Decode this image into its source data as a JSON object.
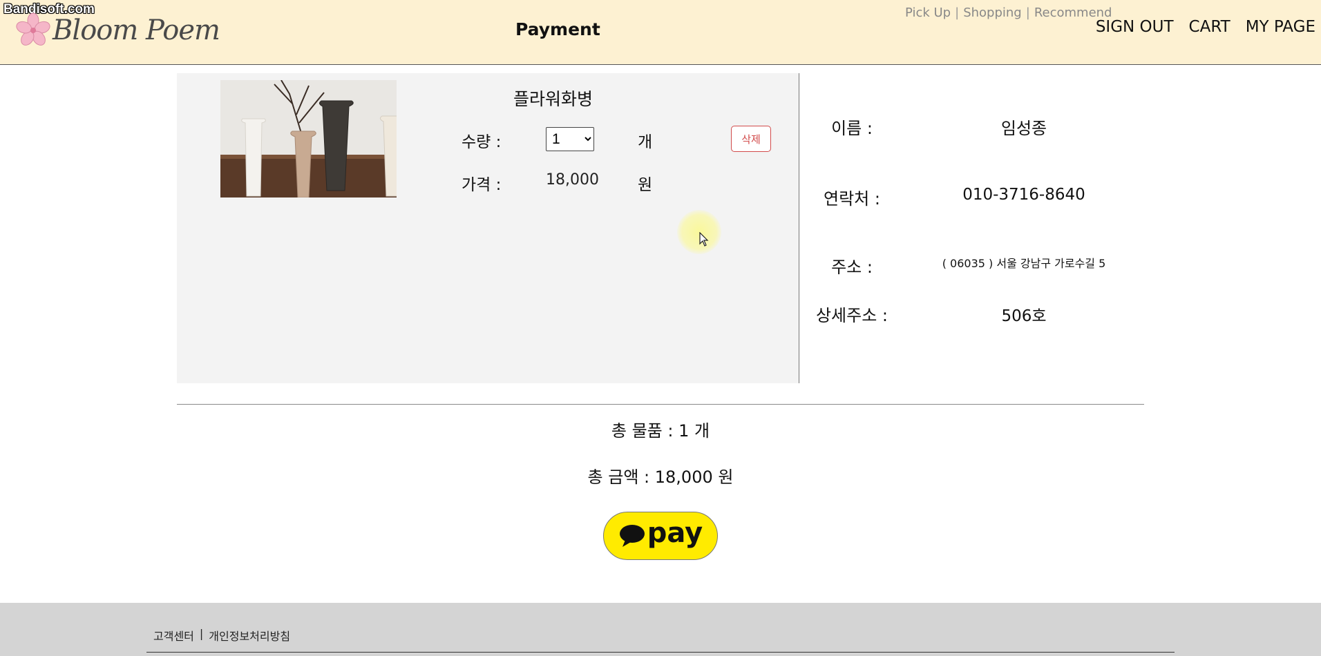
{
  "watermark": "Bandisoft.com",
  "header": {
    "logo_text": "Bloom Poem",
    "page_title": "Payment",
    "subnav": [
      "Pick Up",
      "Shopping",
      "Recommend"
    ],
    "mainnav": [
      "SIGN OUT",
      "CART",
      "MY PAGE"
    ]
  },
  "product": {
    "name": "플라워화병",
    "qty_label": "수량 :",
    "qty_value": "1",
    "qty_unit": "개",
    "price_label": "가격 :",
    "price_value": "18,000",
    "price_unit": "원",
    "delete_label": "삭제"
  },
  "customer": {
    "name_label": "이름 :",
    "name_value": "임성종",
    "phone_label": "연락처 :",
    "phone_value": "010-3716-8640",
    "address_label": "주소 :",
    "address_value": "( 06035 ) 서울 강남구 가로수길 5",
    "detail_label": "상세주소 :",
    "detail_value": "506호"
  },
  "summary": {
    "total_items": "총 물품 : 1 개",
    "total_price": "총 금액 : 18,000 원"
  },
  "pay_button": {
    "label": "pay",
    "color": "#ffeb00"
  },
  "footer": {
    "links": [
      "고객센터",
      "개인정보처리방침"
    ],
    "separator": "|"
  }
}
